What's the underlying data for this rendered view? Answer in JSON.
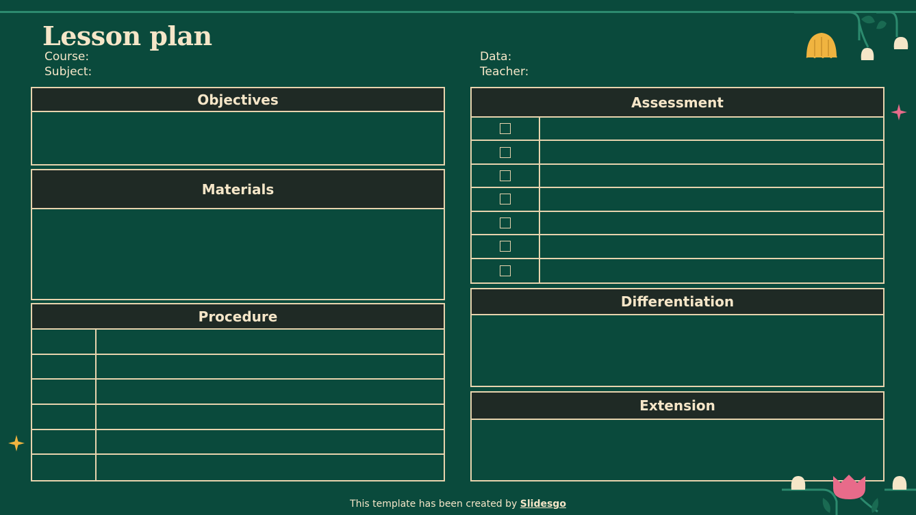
{
  "header": {
    "title": "Lesson plan",
    "course_label": "Course:",
    "subject_label": "Subject:",
    "date_label": "Data:",
    "teacher_label": "Teacher:"
  },
  "sections": {
    "objectives": "Objectives",
    "materials": "Materials",
    "procedure": "Procedure",
    "assessment": "Assessment",
    "differentiation": "Differentiation",
    "extension": "Extension"
  },
  "procedure_rows": 6,
  "assessment_rows": 7,
  "footer": {
    "text": "This template has been created by ",
    "brand": "Slidesgo"
  },
  "colors": {
    "background": "#0a4a3c",
    "header_fill": "#1f2a25",
    "border": "#e8d4ae",
    "text": "#f5e6c8",
    "accent_pink": "#e86b8a",
    "accent_yellow": "#f0b440"
  },
  "icons": [
    "star-icon",
    "flower-icon",
    "checkbox-icon"
  ]
}
